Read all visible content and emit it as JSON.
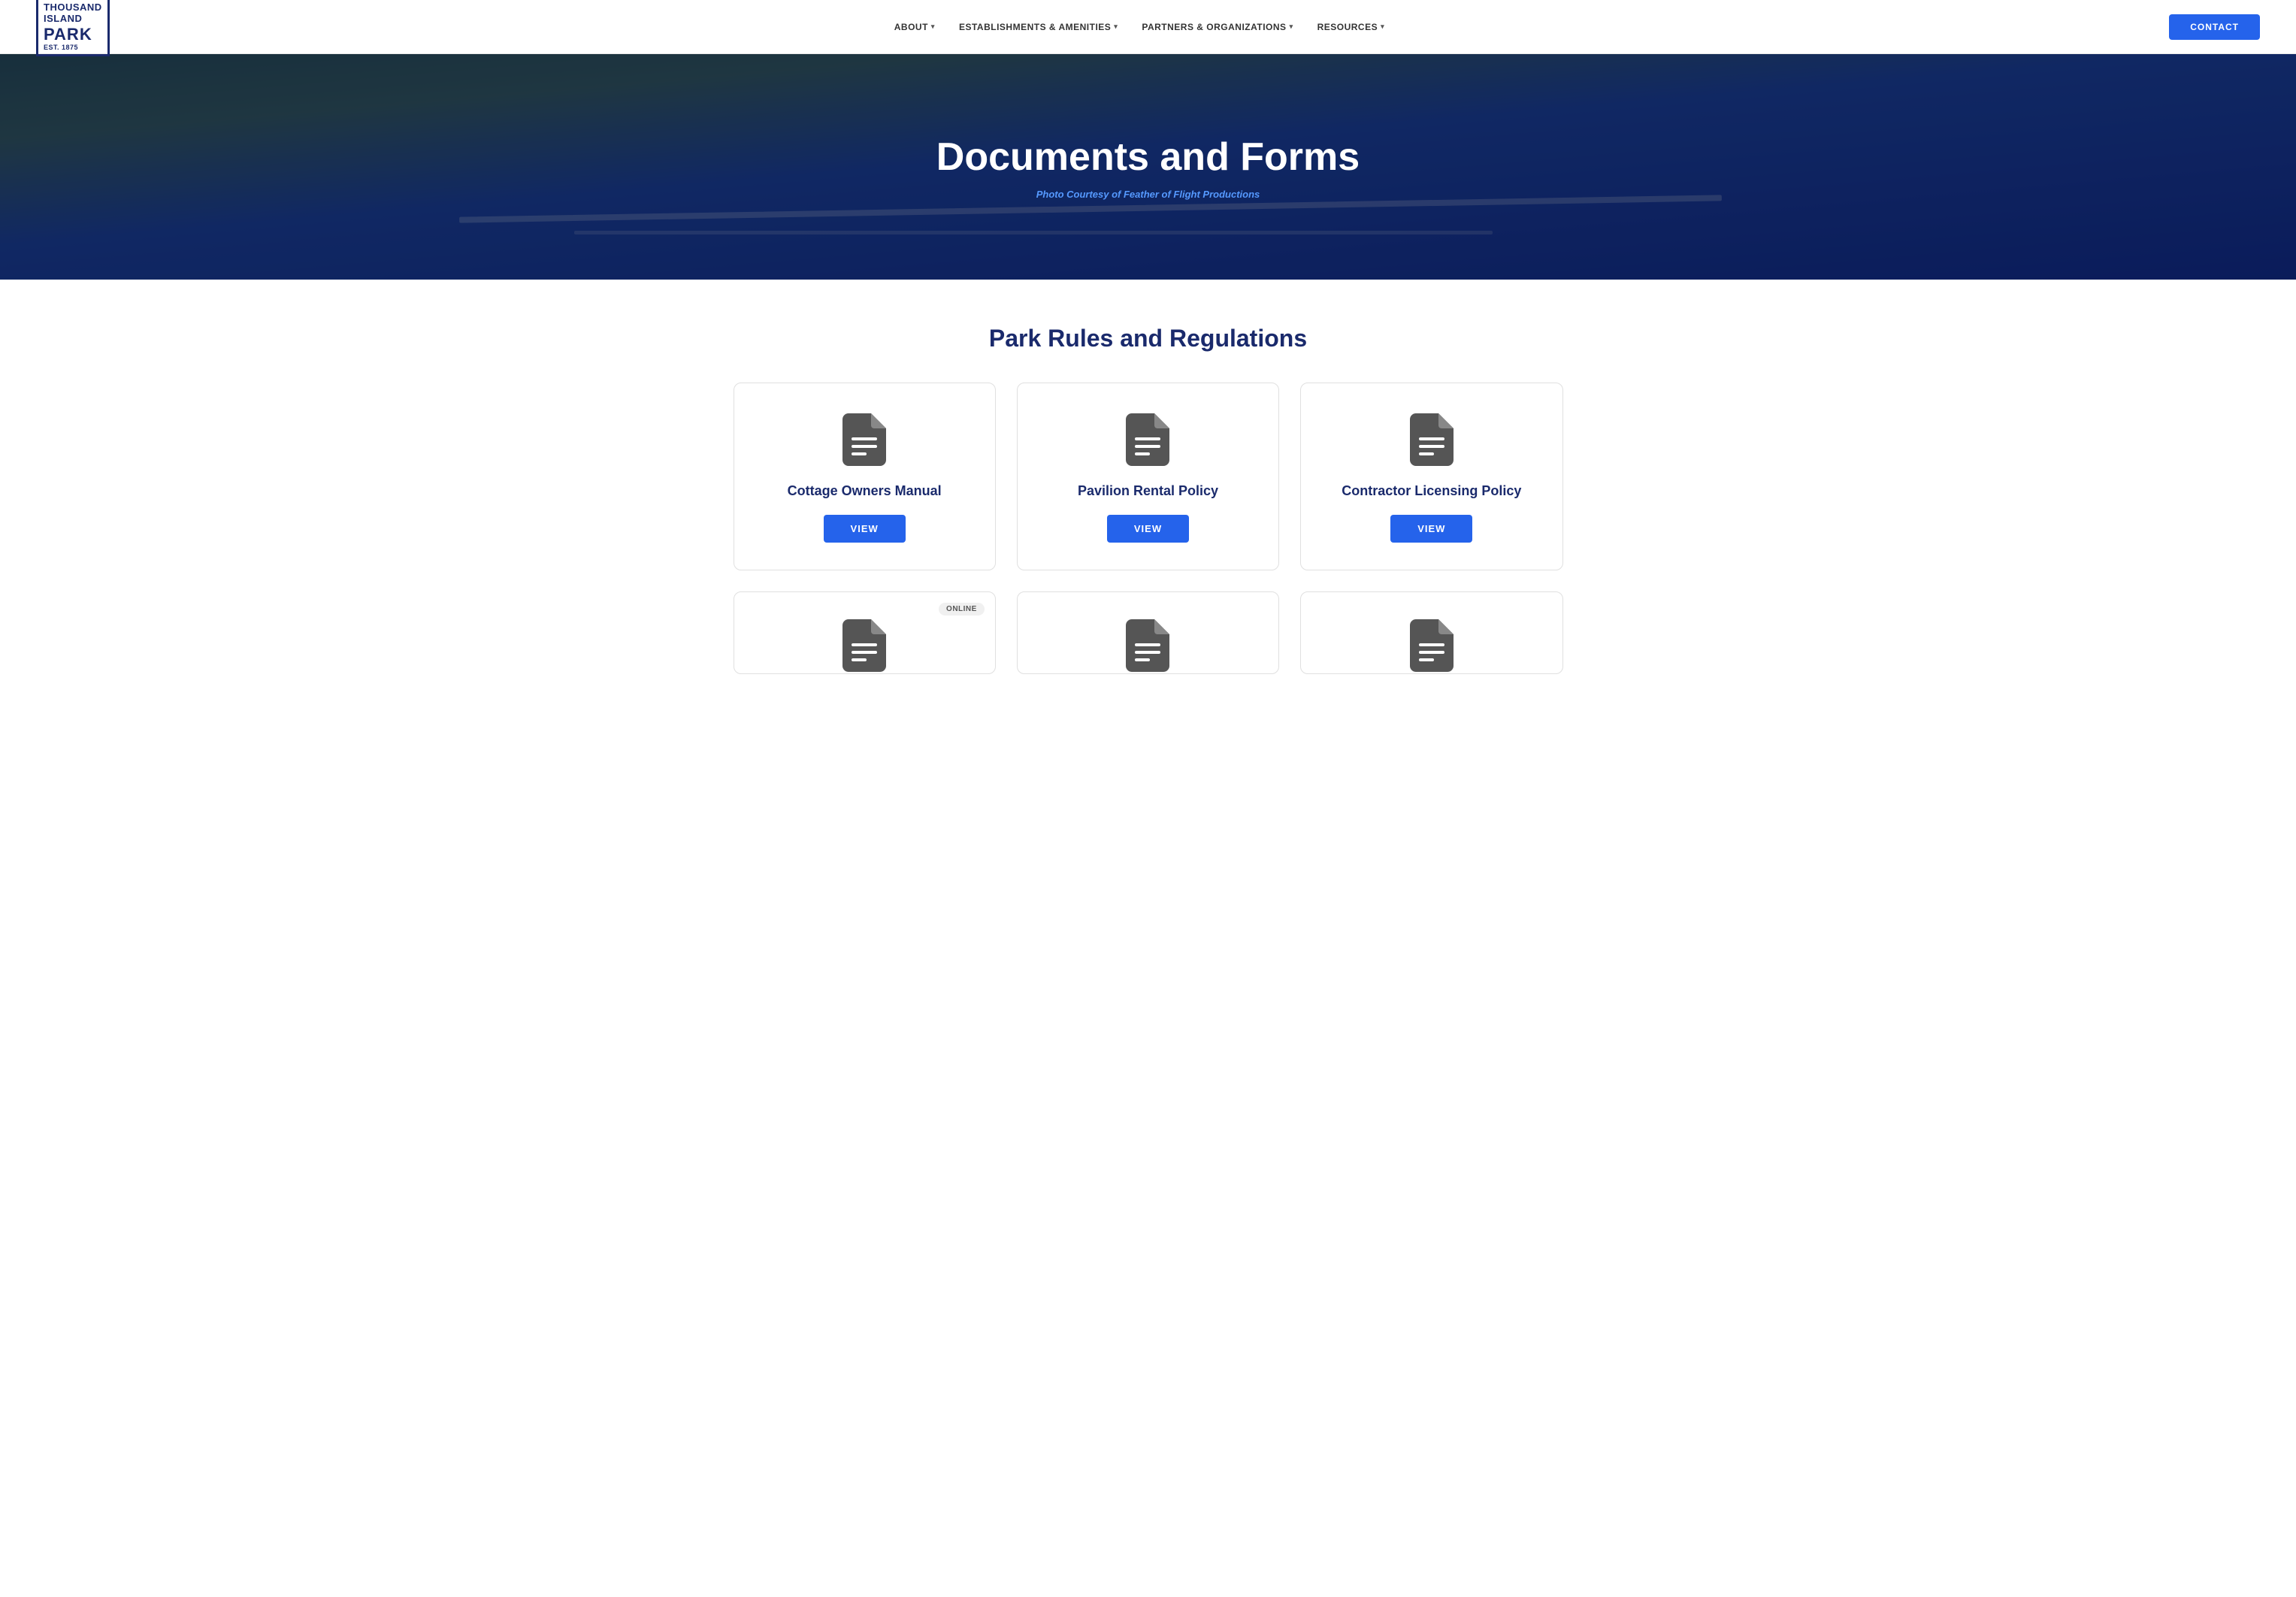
{
  "brand": {
    "line1": "THOUSAND",
    "line2": "ISLAND",
    "line3": "PARK",
    "est": "EST. 1875"
  },
  "nav": {
    "links": [
      {
        "label": "ABOUT",
        "hasDropdown": true
      },
      {
        "label": "ESTABLISHMENTS & AMENITIES",
        "hasDropdown": true
      },
      {
        "label": "PARTNERS & ORGANIZATIONS",
        "hasDropdown": true
      },
      {
        "label": "RESOURCES",
        "hasDropdown": true
      }
    ],
    "contact_label": "CONTACT"
  },
  "hero": {
    "title": "Documents and Forms",
    "subtitle": "Photo Courtesy of Feather of Flight Productions"
  },
  "main": {
    "section_title": "Park Rules and Regulations",
    "cards": [
      {
        "title": "Cottage Owners Manual",
        "view_label": "VIEW",
        "online_badge": null
      },
      {
        "title": "Pavilion Rental Policy",
        "view_label": "VIEW",
        "online_badge": null
      },
      {
        "title": "Contractor Licensing Policy",
        "view_label": "VIEW",
        "online_badge": null
      }
    ],
    "cards_row2": [
      {
        "title": "",
        "online_badge": "ONLINE"
      },
      {
        "title": "",
        "online_badge": null
      },
      {
        "title": "",
        "online_badge": null
      }
    ]
  }
}
